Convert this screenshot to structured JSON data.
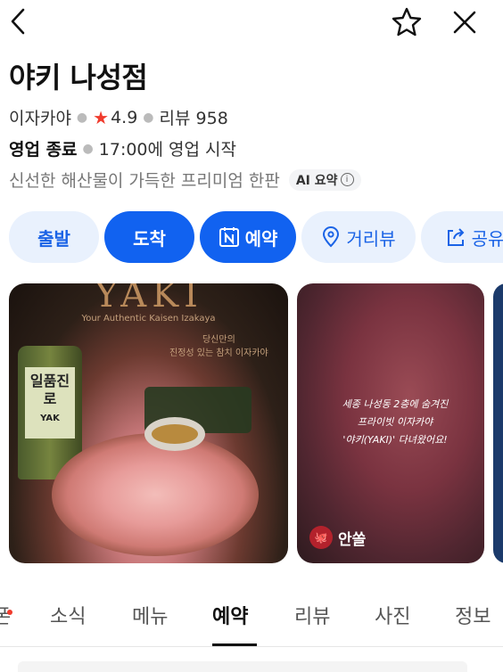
{
  "place": {
    "name": "야키 나성점",
    "category": "이자카야",
    "rating": "4.9",
    "review_label": "리뷰 958"
  },
  "hours": {
    "status": "영업 종료",
    "next_open": "17:00에 영업 시작"
  },
  "summary": {
    "text": "신선한 해산물이 가득한 프리미엄 한판",
    "ai_badge": "AI 요약",
    "info_glyph": "i"
  },
  "actions": [
    {
      "label": "출발",
      "icon": "none"
    },
    {
      "label": "도착",
      "icon": "none"
    },
    {
      "label": "예약",
      "icon": "naver-calendar-icon"
    },
    {
      "label": "거리뷰",
      "icon": "location-pin-icon"
    },
    {
      "label": "공유",
      "icon": "share-icon"
    }
  ],
  "photos": {
    "photo1": {
      "logo": "YAKI",
      "subtitle": "Your Authentic Kaisen Izakaya",
      "tagline_line1": "당신만의",
      "tagline_line2": "진정성 있는 참치 이자카야",
      "bottle_label": "일품진로",
      "bottle_brand": "YAK"
    },
    "photo2": {
      "caption_line1": "세종 나성동 2층에 숨겨진",
      "caption_line2": "프라이빗 이자카야",
      "caption_line3": "'야키(YAKI)' 다녀왔어요!",
      "source_name": "안쏠",
      "source_badge": "🐙"
    }
  },
  "tabs": [
    {
      "label": "쿠폰",
      "visible_text": "폰",
      "has_dot": true
    },
    {
      "label": "소식"
    },
    {
      "label": "메뉴"
    },
    {
      "label": "예약",
      "active": true
    },
    {
      "label": "리뷰"
    },
    {
      "label": "사진"
    },
    {
      "label": "정보"
    }
  ],
  "colors": {
    "primary": "#1162f0",
    "primary_light": "#e9f1fd",
    "rating_star": "#f03b2d"
  }
}
